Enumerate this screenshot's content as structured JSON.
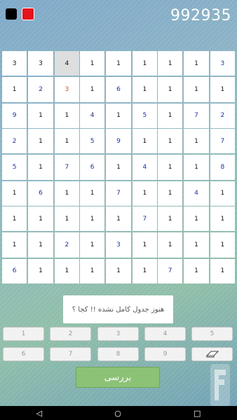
{
  "header": {
    "score": "992935"
  },
  "board": {
    "rows": [
      [
        "3",
        "3",
        "4",
        "1",
        "1",
        "1",
        "1",
        "1",
        "3"
      ],
      [
        "1",
        "2",
        "3",
        "1",
        "6",
        "1",
        "1",
        "1",
        "1"
      ],
      [
        "9",
        "1",
        "1",
        "4",
        "1",
        "5",
        "1",
        "7",
        "2"
      ],
      [
        "2",
        "1",
        "1",
        "5",
        "9",
        "1",
        "1",
        "1",
        "7"
      ],
      [
        "5",
        "1",
        "7",
        "6",
        "1",
        "4",
        "1",
        "1",
        "8"
      ],
      [
        "1",
        "6",
        "1",
        "1",
        "7",
        "1",
        "1",
        "4",
        "1"
      ],
      [
        "1",
        "1",
        "1",
        "1",
        "1",
        "7",
        "1",
        "1",
        "1"
      ],
      [
        "1",
        "1",
        "2",
        "1",
        "3",
        "1",
        "1",
        "1",
        "1"
      ],
      [
        "6",
        "1",
        "1",
        "1",
        "1",
        "1",
        "7",
        "1",
        "1"
      ]
    ],
    "given": [
      [
        0,
        0,
        0,
        0,
        0,
        0,
        0,
        0,
        1
      ],
      [
        0,
        1,
        0,
        0,
        1,
        0,
        0,
        0,
        0
      ],
      [
        1,
        0,
        0,
        1,
        0,
        1,
        0,
        1,
        1
      ],
      [
        1,
        0,
        0,
        1,
        1,
        0,
        0,
        0,
        1
      ],
      [
        1,
        0,
        1,
        1,
        0,
        1,
        0,
        0,
        1
      ],
      [
        0,
        1,
        0,
        0,
        1,
        0,
        0,
        1,
        0
      ],
      [
        0,
        0,
        0,
        0,
        0,
        1,
        0,
        0,
        0
      ],
      [
        0,
        0,
        1,
        0,
        1,
        0,
        0,
        0,
        0
      ],
      [
        1,
        0,
        0,
        0,
        0,
        0,
        1,
        0,
        0
      ]
    ],
    "selected_cell": [
      0,
      2
    ],
    "error_cell": [
      1,
      2
    ]
  },
  "message": "هنوز جدول کامل نشده !! کجا ؟",
  "keypad": {
    "row1": [
      "1",
      "2",
      "3",
      "4",
      "5"
    ],
    "row2": [
      "6",
      "7",
      "8",
      "9"
    ],
    "eraser_icon": "eraser-icon"
  },
  "check_button": "بررسی",
  "colors": {
    "given": "#1a2fb8",
    "error": "#e2522c",
    "check": "#8cc276",
    "red_square": "#e8121b"
  }
}
